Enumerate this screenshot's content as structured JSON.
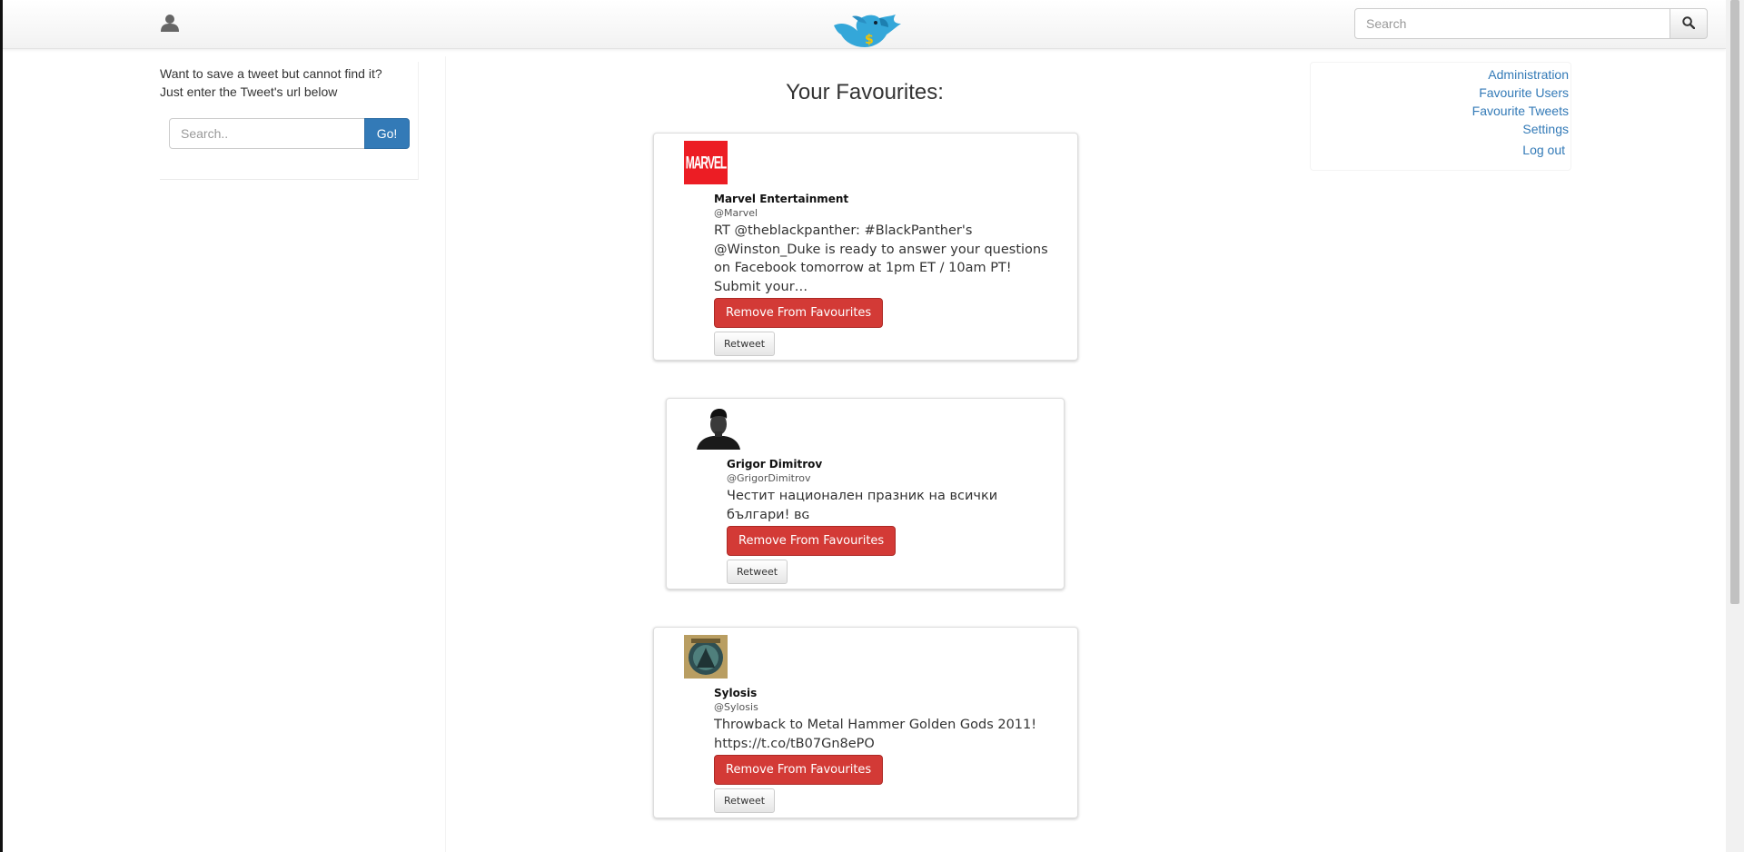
{
  "header": {
    "search_placeholder": "Search",
    "icons": {
      "user": "user-icon",
      "logo": "bird-logo",
      "search": "search-icon"
    }
  },
  "left_panel": {
    "intro_line1": "Want to save a tweet but cannot find it?",
    "intro_line2": "Just enter the Tweet's url below",
    "input_placeholder": "Search..",
    "go_label": "Go!"
  },
  "main": {
    "title": "Your Favourites:"
  },
  "right_nav": {
    "links": [
      "Administration",
      "Favourite Users",
      "Favourite Tweets",
      "Settings",
      "Log out"
    ]
  },
  "tweets": [
    {
      "name": "Marvel Entertainment",
      "handle": "@Marvel",
      "text": "RT @theblackpanther: #BlackPanther's @Winston_Duke is ready to answer your questions on Facebook tomorrow at 1pm ET / 10am PT! Submit your…",
      "avatar_text": "MARVEL",
      "remove_label": "Remove From Favourites",
      "retweet_label": "Retweet"
    },
    {
      "name": "Grigor Dimitrov",
      "handle": "@GrigorDimitrov",
      "text": "Честит национален празник на всички българи! ʙɢ",
      "remove_label": "Remove From Favourites",
      "retweet_label": "Retweet"
    },
    {
      "name": "Sylosis",
      "handle": "@Sylosis",
      "text": "Throwback to Metal Hammer Golden Gods 2011! https://t.co/tB07Gn8ePO",
      "remove_label": "Remove From Favourites",
      "retweet_label": "Retweet"
    }
  ],
  "colors": {
    "primary": "#337ab7",
    "danger": "#d33a36",
    "marvel_red": "#ec1d24"
  }
}
